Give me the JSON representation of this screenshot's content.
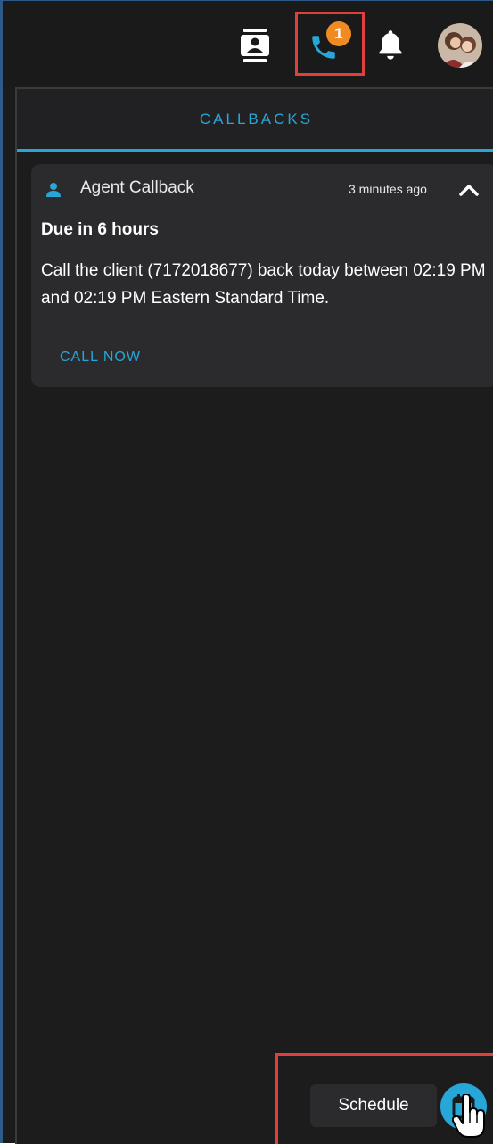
{
  "topbar": {
    "icons": {
      "contacts": "contact-card-icon",
      "phone": "phone-icon",
      "bell": "bell-icon",
      "avatar": "user-avatar"
    },
    "phone_badge": "1"
  },
  "tabs": [
    {
      "label": "CALLBACKS"
    }
  ],
  "callback": {
    "type_label": "Agent Callback",
    "time_ago": "3 minutes ago",
    "due": "Due in 6 hours",
    "message": "Call the client (7172018677) back today between 02:19 PM and 02:19 PM Eastern Standard Time.",
    "action_label": "CALL NOW"
  },
  "schedule": {
    "tooltip": "Schedule"
  },
  "colors": {
    "accent": "#27a6d8",
    "badge": "#ef8b22",
    "highlight": "#e0403c",
    "background": "#1b1b1c",
    "card": "#2b2b2d"
  }
}
